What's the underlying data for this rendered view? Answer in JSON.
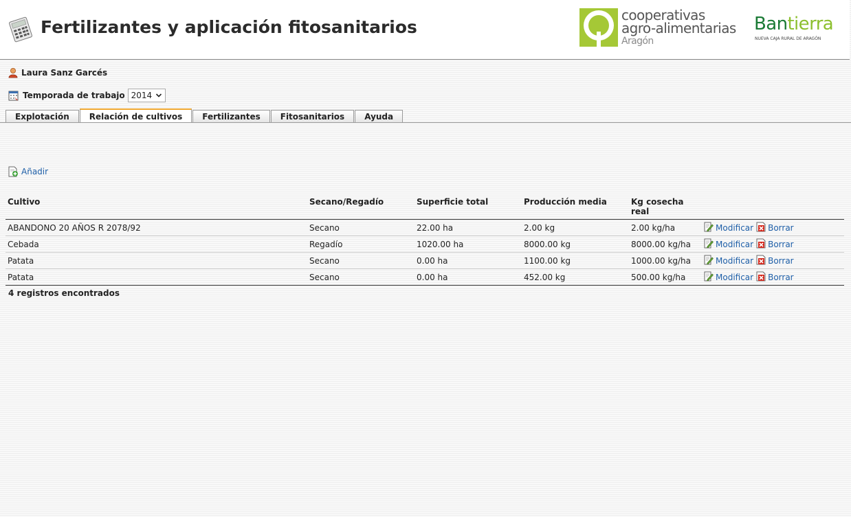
{
  "header": {
    "title": "Fertilizantes y aplicación fitosanitarios",
    "logo_coop": {
      "line1": "cooperativas",
      "line2": "agro-alimentarias",
      "line3": "Aragón"
    },
    "logo_bantierra": {
      "name_part1": "Ban",
      "name_part2": "tierra",
      "tagline": "NUEVA CAJA RURAL DE ARAGÓN"
    }
  },
  "user": {
    "name": "Laura Sanz Garcés"
  },
  "season": {
    "label": "Temporada de trabajo",
    "selected": "2014"
  },
  "tabs": [
    {
      "label": "Explotación",
      "active": false
    },
    {
      "label": "Relación de cultivos",
      "active": true
    },
    {
      "label": "Fertilizantes",
      "active": false
    },
    {
      "label": "Fitosanitarios",
      "active": false
    },
    {
      "label": "Ayuda",
      "active": false
    }
  ],
  "add_label": "Añadir",
  "table": {
    "headers": {
      "cultivo": "Cultivo",
      "secano": "Secano/Regadío",
      "superficie": "Superficie total",
      "produccion": "Producción media",
      "kg": "Kg cosecha real"
    },
    "rows": [
      {
        "cultivo": "ABANDONO 20 AÑOS R 2078/92",
        "secano": "Secano",
        "superficie": "22.00 ha",
        "produccion": "2.00 kg",
        "kg": "2.00 kg/ha",
        "modify": "Modificar",
        "delete": "Borrar"
      },
      {
        "cultivo": "Cebada",
        "secano": "Regadío",
        "superficie": "1020.00 ha",
        "produccion": "8000.00 kg",
        "kg": "8000.00 kg/ha",
        "modify": "Modificar",
        "delete": "Borrar"
      },
      {
        "cultivo": "Patata",
        "secano": "Secano",
        "superficie": "0.00 ha",
        "produccion": "1100.00 kg",
        "kg": "1000.00 kg/ha",
        "modify": "Modificar",
        "delete": "Borrar"
      },
      {
        "cultivo": "Patata",
        "secano": "Secano",
        "superficie": "0.00 ha",
        "produccion": "452.00 kg",
        "kg": "500.00 kg/ha",
        "modify": "Modificar",
        "delete": "Borrar"
      }
    ]
  },
  "footer": {
    "count_label": "4 registros encontrados"
  },
  "icons": {
    "app": "calculator-icon",
    "user": "user-icon",
    "calendar": "calendar-icon",
    "add": "add-document-icon",
    "edit": "edit-icon",
    "delete": "delete-icon",
    "dropdown": "chevron-down-icon"
  },
  "colors": {
    "link": "#1e5fa8",
    "active_tab": "#f0a830",
    "coop_green": "#a5c836",
    "bantierra_green": "#1a7a35"
  }
}
